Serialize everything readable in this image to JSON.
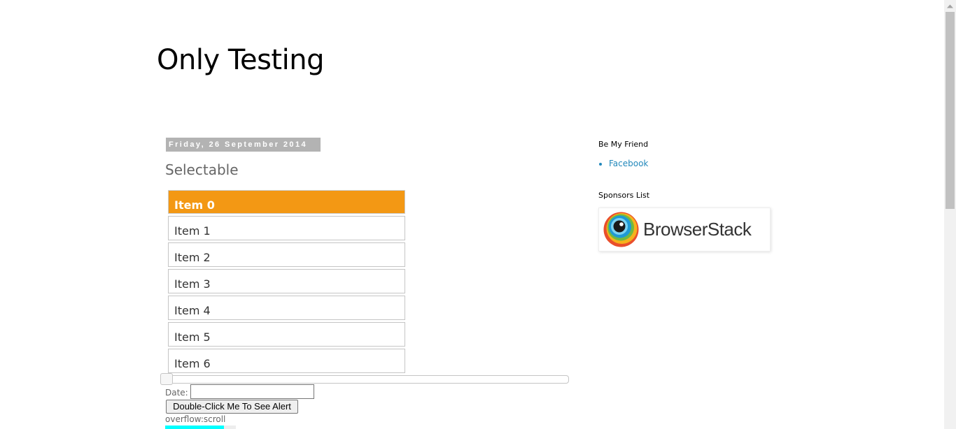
{
  "blog": {
    "title": "Only Testing"
  },
  "post": {
    "date": "Friday, 26 September 2014",
    "title": "Selectable",
    "items": [
      "Item 0",
      "Item 1",
      "Item 2",
      "Item 3",
      "Item 4",
      "Item 5",
      "Item 6"
    ],
    "selected_index": 0,
    "slider_value": 0,
    "date_label": "Date:",
    "date_value": "",
    "double_click_label": "Double-Click Me To See Alert",
    "overflow_label": "overflow:scroll"
  },
  "sidebar": {
    "friend_heading": "Be My Friend",
    "friend_links": [
      "Facebook"
    ],
    "sponsors_heading": "Sponsors List",
    "sponsor_name": "BrowserStack"
  },
  "colors": {
    "selected": "#f39814",
    "link": "#2288bb",
    "date_header_bg": "#b3b3b3",
    "overflow_fill": "#00ffff"
  }
}
